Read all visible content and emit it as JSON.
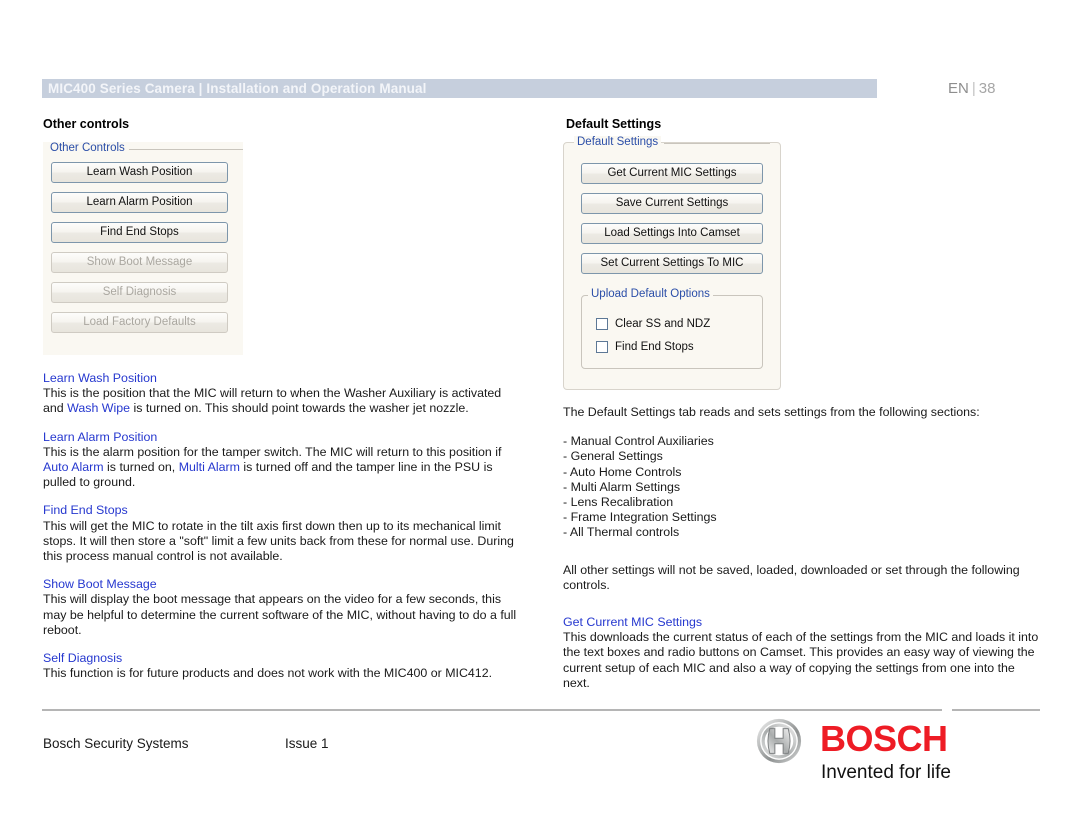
{
  "header": {
    "title": "MIC400 Series Camera | Installation and Operation Manual",
    "language": "EN",
    "separator": "|",
    "page_number": "38"
  },
  "columns": {
    "left_heading": "Other controls",
    "right_heading": "Default Settings"
  },
  "other_controls_panel": {
    "legend": "Other Controls",
    "buttons": [
      {
        "label": "Learn Wash Position",
        "enabled": true
      },
      {
        "label": "Learn Alarm Position",
        "enabled": true
      },
      {
        "label": "Find End Stops",
        "enabled": true
      },
      {
        "label": "Show Boot Message",
        "enabled": false
      },
      {
        "label": "Self Diagnosis",
        "enabled": false
      },
      {
        "label": "Load Factory Defaults",
        "enabled": false
      }
    ]
  },
  "default_settings_panel": {
    "legend": "Default Settings",
    "buttons": [
      {
        "label": "Get Current MIC Settings",
        "enabled": true
      },
      {
        "label": "Save Current Settings",
        "enabled": true
      },
      {
        "label": "Load Settings Into Camset",
        "enabled": true
      },
      {
        "label": "Set Current Settings To MIC",
        "enabled": true
      }
    ],
    "upload_group": {
      "legend": "Upload Default Options",
      "checkboxes": [
        {
          "label": "Clear SS and NDZ",
          "checked": false
        },
        {
          "label": "Find End Stops",
          "checked": false
        }
      ]
    }
  },
  "left_column": {
    "sections": [
      {
        "heading": "Learn Wash Position",
        "body_1": "This is the position that the MIC will return to when the Washer Auxiliary is activated and ",
        "xref_1": "Wash Wipe",
        "body_2": " is turned on. This should point towards the washer jet nozzle."
      },
      {
        "heading": "Learn Alarm Position",
        "body_1": "This is the alarm position for the tamper switch. The MIC will return to this position if ",
        "xref_1": "Auto Alarm",
        "body_2": " is turned on, ",
        "xref_2": "Multi Alarm",
        "body_3": " is turned off and the tamper line in the PSU is pulled to ground."
      },
      {
        "heading": "Find End Stops",
        "body_1": "This will get the MIC to rotate in the tilt axis first down then up to its mechanical limit stops. It will then store a \"soft\" limit a few units back from these for normal use. During this process manual control is not available."
      },
      {
        "heading": "Show Boot Message",
        "body_1": "This will display the boot message that appears on the video for a few seconds, this may be helpful to determine the current software of the MIC, without having to do a full reboot."
      },
      {
        "heading": "Self Diagnosis",
        "body_1": "This function is for future products and does not work with the MIC400 or MIC412."
      }
    ]
  },
  "right_column": {
    "intro": "The Default Settings tab reads and sets settings from the following sections:",
    "sections_list": [
      "- Manual Control Auxiliaries",
      "- General Settings",
      "- Auto Home Controls",
      "- Multi Alarm Settings",
      "- Lens Recalibration",
      "- Frame Integration Settings",
      "- All Thermal controls"
    ],
    "note": "All other settings will not be saved, loaded, downloaded or set through the following controls.",
    "get_settings_heading": "Get Current MIC Settings",
    "get_settings_body": "This downloads the current status of each of the settings from the MIC and loads it into the text boxes and radio buttons on Camset. This provides an easy way of viewing the current setup of each MIC and also a way of copying the settings from one into the next."
  },
  "footer": {
    "company": "Bosch Security Systems",
    "issue": "Issue 1",
    "brand": "BOSCH",
    "tagline": "Invented for life"
  },
  "colors": {
    "header_bar": "#c6cfdd",
    "heading_link": "#2638cf",
    "group_legend": "#2b4ea8",
    "brand_red": "#ee1c25"
  }
}
